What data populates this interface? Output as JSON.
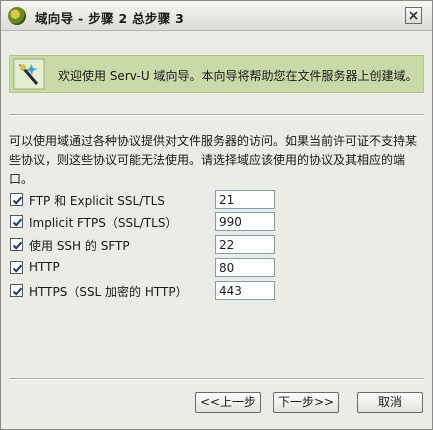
{
  "window": {
    "title": "域向导 - 步骤 2 总步骤 3"
  },
  "banner": {
    "text": "欢迎使用 Serv-U 域向导。本向导将帮助您在文件服务器上创建域。"
  },
  "description": "可以使用域通过各种协议提供对文件服务器的访问。如果当前许可证不支持某些协议，则这些协议可能无法使用。请选择域应该使用的协议及其相应的端口。",
  "protocols": [
    {
      "label": "FTP 和 Explicit SSL/TLS",
      "port": "21",
      "checked": true
    },
    {
      "label": "Implicit FTPS（SSL/TLS）",
      "port": "990",
      "checked": true
    },
    {
      "label": "使用 SSH 的 SFTP",
      "port": "22",
      "checked": true
    },
    {
      "label": "HTTP",
      "port": "80",
      "checked": true
    },
    {
      "label": "HTTPS（SSL 加密的 HTTP）",
      "port": "443",
      "checked": true
    }
  ],
  "buttons": {
    "back": "<<上一步",
    "next": "下一步>>",
    "cancel": "取消"
  },
  "icons": {
    "app": "serv-u-logo-icon",
    "close": "close-icon",
    "wizard": "wizard-wand-icon",
    "check": "checkmark-icon"
  }
}
